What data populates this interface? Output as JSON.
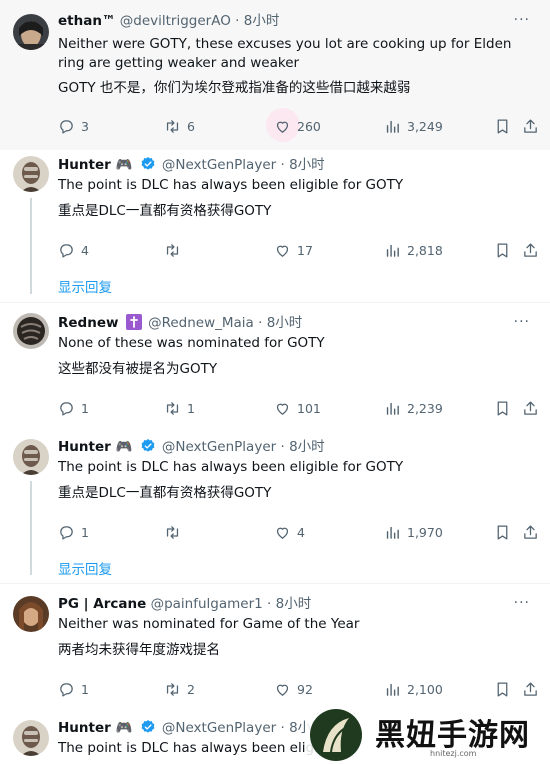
{
  "tweets": [
    {
      "name": "ethan™",
      "handle": "@deviltriggerAO",
      "dot": "·",
      "time": "8小时",
      "text_en": "Neither were GOTY, these excuses you lot are cooking up for Elden ring are getting weaker and weaker",
      "text_zh": "GOTY 也不是，你们为埃尔登戒指准备的这些借口越来越弱",
      "replies": "3",
      "retweets": "6",
      "likes": "260",
      "views": "3,249",
      "badge": ""
    },
    {
      "name": "Hunter 🎮",
      "handle": "@NextGenPlayer",
      "dot": "·",
      "time": "8小时",
      "text_en": "The point is DLC has always been eligible for GOTY",
      "text_zh": "重点是DLC一直都有资格获得GOTY",
      "replies": "4",
      "retweets": "",
      "likes": "17",
      "views": "2,818",
      "badge": "verified-icon",
      "show_replies": "显示回复"
    },
    {
      "name": "Rednew",
      "handle": "@Rednew_Maia",
      "dot": "·",
      "time": "8小时",
      "text_en": "None of these was nominated for GOTY",
      "text_zh": "这些都没有被提名为GOTY",
      "replies": "1",
      "retweets": "1",
      "likes": "101",
      "views": "2,239",
      "badge": "cross-icon"
    },
    {
      "name": "Hunter 🎮",
      "handle": "@NextGenPlayer",
      "dot": "·",
      "time": "8小时",
      "text_en": "The point is DLC has always been eligible for GOTY",
      "text_zh": "重点是DLC一直都有资格获得GOTY",
      "replies": "1",
      "retweets": "",
      "likes": "4",
      "views": "1,970",
      "badge": "verified-icon",
      "show_replies": "显示回复"
    },
    {
      "name": "PG | Arcane",
      "handle": "@painfulgamer1",
      "dot": "·",
      "time": "8小时",
      "text_en": "Neither was nominated for Game of the Year",
      "text_zh": "两者均未获得年度游戏提名",
      "replies": "1",
      "retweets": "2",
      "likes": "92",
      "views": "2,100",
      "badge": ""
    },
    {
      "name": "Hunter 🎮",
      "handle": "@NextGenPlayer",
      "dot": "·",
      "time": "8小时",
      "text_en": "The point is DLC has always been eligi",
      "text_zh": "",
      "badge": "verified-icon"
    }
  ],
  "watermark": {
    "text": "黑妞手游网",
    "url": "hnitezj.com"
  },
  "colors": {
    "accent": "#1d9bf0",
    "muted": "#536471",
    "like_hover": "#f91880"
  }
}
